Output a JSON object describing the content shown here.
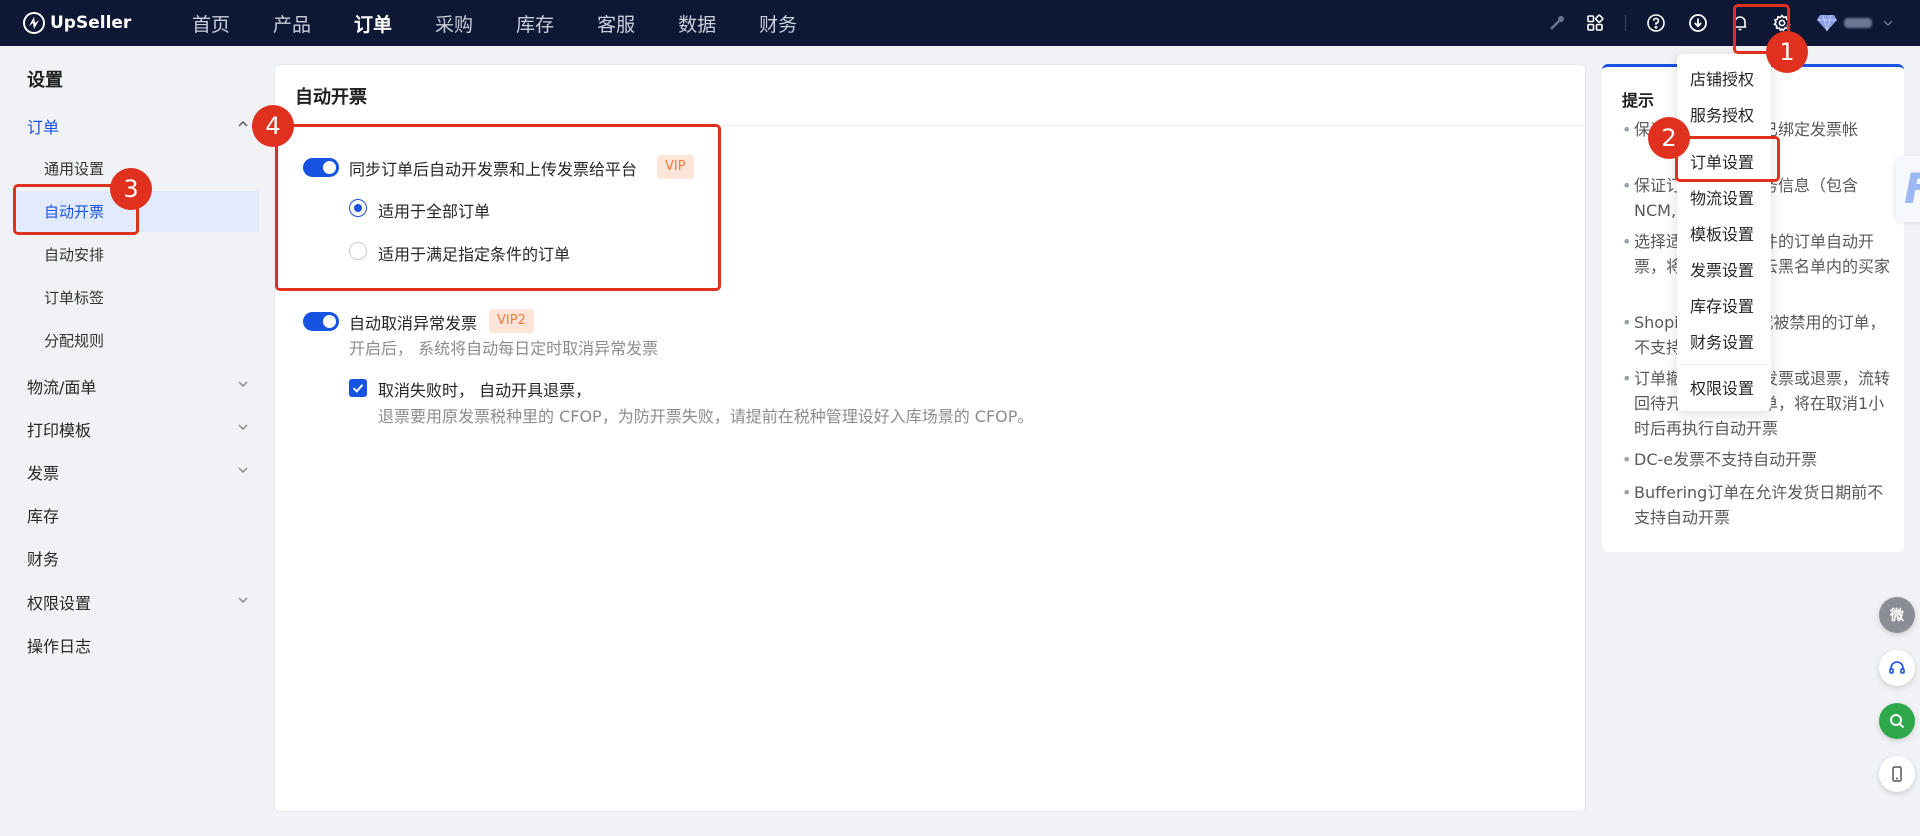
{
  "brand": {
    "name": "UpSeller"
  },
  "nav": {
    "items": [
      "首页",
      "产品",
      "订单",
      "采购",
      "库存",
      "客服",
      "数据",
      "财务"
    ],
    "active_index": 2
  },
  "topbar_icons": [
    "key-icon",
    "apps-icon",
    "help-icon",
    "download-icon",
    "bell-icon",
    "gear-icon"
  ],
  "sidebar": {
    "title": "设置",
    "order_group": {
      "label": "订单",
      "children": [
        "通用设置",
        "自动开票",
        "自动安排",
        "订单标签",
        "分配规则"
      ],
      "active_child": "自动开票"
    },
    "groups": [
      {
        "label": "物流/面单",
        "expandable": true
      },
      {
        "label": "打印模板",
        "expandable": true
      },
      {
        "label": "发票",
        "expandable": true
      },
      {
        "label": "库存",
        "expandable": false
      },
      {
        "label": "财务",
        "expandable": false
      },
      {
        "label": "权限设置",
        "expandable": true
      },
      {
        "label": "操作日志",
        "expandable": false
      }
    ]
  },
  "main": {
    "title": "自动开票",
    "auto_invoice": {
      "label": "同步订单后自动开发票和上传发票给平台",
      "enabled": true,
      "badge": "VIP",
      "options": [
        "适用于全部订单",
        "适用于满足指定条件的订单"
      ],
      "selected_option": "适用于全部订单"
    },
    "auto_cancel": {
      "label": "自动取消异常发票",
      "enabled": true,
      "badge": "VIP2",
      "description": "开启后， 系统将自动每日定时取消异常发票",
      "checkbox_label": "取消失败时， 自动开具退票，",
      "checkbox_checked": true,
      "checkbox_hint": "退票要用原发票税种里的 CFOP，为防开票失败，请提前在税种管理设好入库场景的 CFOP。"
    }
  },
  "tips": {
    "title": "提示",
    "items": [
      "保证订单所在店铺已绑定发票帐",
      "保证订单商品的税务信息（包含NCM, Unit和税种)",
      "选择适用于满足条件的订单自动开票，将排除风险和云黑名单内的买家",
      "Shopify订单取消或被禁用的订单，不支持自动开票",
      "订单撤销后会取消发票或退票，流转回待开票状态的订单，将在取消1小时后再执行自动开票",
      "DC-e发票不支持自动开票",
      "Buffering订单在允许发货日期前不支持自动开票"
    ]
  },
  "settings_menu": {
    "items": [
      "店铺授权",
      "服务授权",
      "订单设置",
      "物流设置",
      "模板设置",
      "发票设置",
      "库存设置",
      "财务设置",
      "权限设置"
    ],
    "highlighted": "订单设置"
  },
  "annotations": [
    "1",
    "2",
    "3",
    "4"
  ],
  "float_buttons": [
    "wechat-icon",
    "headset-icon",
    "search-icon",
    "mobile-icon"
  ],
  "float_wechat_label": "微",
  "edge_tab_letter": "F",
  "colors": {
    "primary": "#1553e0",
    "topbar": "#0e1834",
    "annotation": "#e0301e",
    "vip_text": "#f07b3f",
    "vip_bg": "#fde6d9",
    "green": "#2ea84a"
  }
}
